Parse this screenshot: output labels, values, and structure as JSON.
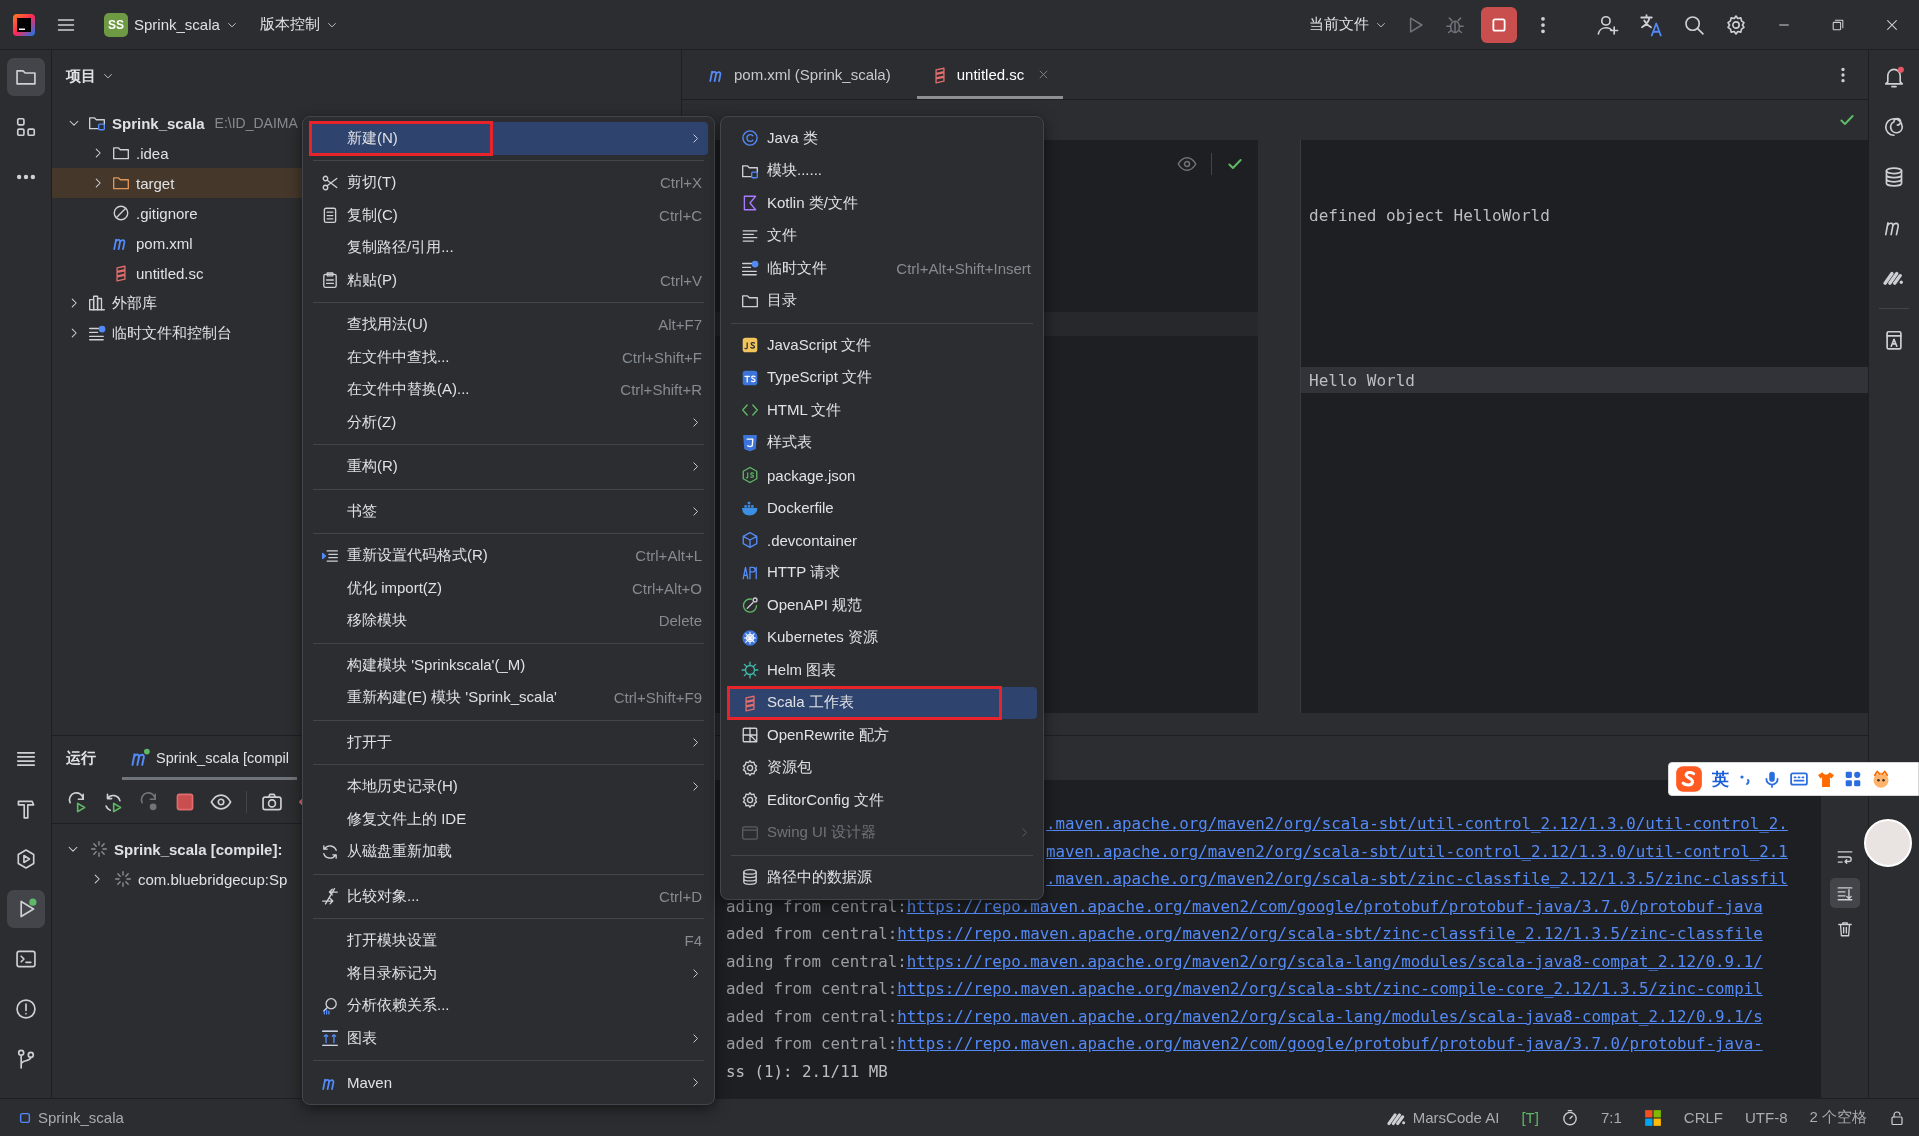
{
  "title_bar": {
    "project_badge": "SS",
    "project_name": "Sprink_scala",
    "vcs_menu": "版本控制",
    "run_config": "当前文件"
  },
  "left_toolbar": {
    "top": [
      {
        "selected": true
      },
      {
        "selected": false
      },
      {
        "selected": false
      }
    ],
    "bottom": [
      {
        "selected": false
      },
      {
        "selected": false
      },
      {
        "selected": false
      },
      {
        "selected": true
      },
      {
        "selected": false
      },
      {
        "selected": false
      },
      {
        "selected": false
      }
    ]
  },
  "project_panel": {
    "title": "项目",
    "tree": [
      {
        "name": "Sprink_scala",
        "path": "E:\\ID_DAIMA",
        "kind": "module",
        "expanded": true,
        "selected": false,
        "children": [
          {
            "name": ".idea",
            "kind": "folder",
            "expanded": false,
            "selected": false
          },
          {
            "name": "target",
            "kind": "excluded",
            "expanded": false,
            "selected": true
          },
          {
            "name": ".gitignore",
            "kind": "ignore",
            "selected": false
          },
          {
            "name": "pom.xml",
            "kind": "maven",
            "selected": false
          },
          {
            "name": "untitled.sc",
            "kind": "scala",
            "selected": false
          }
        ]
      },
      {
        "name": "外部库",
        "kind": "library",
        "expanded": false,
        "selected": false
      },
      {
        "name": "临时文件和控制台",
        "kind": "scratch",
        "expanded": false,
        "selected": false
      }
    ]
  },
  "editor": {
    "tabs": [
      {
        "label": "pom.xml (Sprink_scala)",
        "kind": "maven",
        "selected": false,
        "closable": false
      },
      {
        "label": "untitled.sc",
        "kind": "scala",
        "selected": true,
        "closable": true
      }
    ],
    "output": [
      {
        "text": "defined object HelloWorld",
        "highlighted": false
      },
      {
        "text": "Hello World",
        "highlighted": true
      }
    ]
  },
  "run_panel": {
    "title": "运行",
    "tabs": [
      {
        "label": "Sprink_scala [compil",
        "selected": true
      }
    ],
    "tree": [
      {
        "label": "Sprink_scala [compile]:",
        "expanded": true,
        "children": [
          {
            "label": "com.bluebridgecup:Sp",
            "expanded": false
          }
        ]
      }
    ],
    "console": [
      {
        "link": ".maven.apache.org/maven2/org/scala-sbt/util-control_2.12/1.3.0/util-control_2."
      },
      {
        "link": "maven.apache.org/maven2/org/scala-sbt/util-control_2.12/1.3.0/util-control_2.1"
      },
      {
        "link": ".maven.apache.org/maven2/org/scala-sbt/zinc-classfile_2.12/1.3.5/zinc-classfil"
      },
      {
        "prefix": "ading from central:",
        "link": "https://repo.maven.apache.org/maven2/com/google/protobuf/protobuf-java/3.7.0/protobuf-java"
      },
      {
        "prefix": "aded from central:",
        "link": "https://repo.maven.apache.org/maven2/org/scala-sbt/zinc-classfile_2.12/1.3.5/zinc-classfile"
      },
      {
        "prefix": "ading from central:",
        "link": "https://repo.maven.apache.org/maven2/org/scala-lang/modules/scala-java8-compat_2.12/0.9.1/"
      },
      {
        "prefix": "aded from central:",
        "link": "https://repo.maven.apache.org/maven2/org/scala-sbt/zinc-compile-core_2.12/1.3.5/zinc-compil"
      },
      {
        "prefix": "aded from central:",
        "link": "https://repo.maven.apache.org/maven2/org/scala-lang/modules/scala-java8-compat_2.12/0.9.1/s"
      },
      {
        "prefix": "aded from central:",
        "link": "https://repo.maven.apache.org/maven2/com/google/protobuf/protobuf-java/3.7.0/protobuf-java-"
      },
      {
        "text": "ss (1): 2.1/11 MB"
      }
    ]
  },
  "context_menu": {
    "groups": [
      [
        {
          "label": "新建(N)",
          "has_submenu": true,
          "selected": true,
          "marked": true
        }
      ],
      [
        {
          "label": "剪切(T)",
          "shortcut": "Ctrl+X",
          "has_submenu": false,
          "selected": false,
          "marked": false
        },
        {
          "label": "复制(C)",
          "shortcut": "Ctrl+C",
          "has_submenu": false,
          "selected": false,
          "marked": false
        },
        {
          "label": "复制路径/引用...",
          "has_submenu": false,
          "selected": false,
          "marked": false
        },
        {
          "label": "粘贴(P)",
          "shortcut": "Ctrl+V",
          "has_submenu": false,
          "selected": false,
          "marked": false
        }
      ],
      [
        {
          "label": "查找用法(U)",
          "shortcut": "Alt+F7",
          "has_submenu": false,
          "selected": false,
          "marked": false
        },
        {
          "label": "在文件中查找...",
          "shortcut": "Ctrl+Shift+F",
          "has_submenu": false,
          "selected": false,
          "marked": false
        },
        {
          "label": "在文件中替换(A)...",
          "shortcut": "Ctrl+Shift+R",
          "has_submenu": false,
          "selected": false,
          "marked": false
        },
        {
          "label": "分析(Z)",
          "has_submenu": true,
          "selected": false,
          "marked": false
        }
      ],
      [
        {
          "label": "重构(R)",
          "has_submenu": true,
          "selected": false,
          "marked": false
        }
      ],
      [
        {
          "label": "书签",
          "has_submenu": true,
          "selected": false,
          "marked": false
        }
      ],
      [
        {
          "label": "重新设置代码格式(R)",
          "shortcut": "Ctrl+Alt+L",
          "has_submenu": false,
          "selected": false,
          "marked": false
        },
        {
          "label": "优化 import(Z)",
          "shortcut": "Ctrl+Alt+O",
          "has_submenu": false,
          "selected": false,
          "marked": false
        },
        {
          "label": "移除模块",
          "shortcut": "Delete",
          "has_submenu": false,
          "selected": false,
          "marked": false
        }
      ],
      [
        {
          "label": "构建模块 'Sprinkscala'(_M)",
          "has_submenu": false,
          "selected": false,
          "marked": false
        },
        {
          "label": "重新构建(E) 模块 'Sprink_scala'",
          "shortcut": "Ctrl+Shift+F9",
          "has_submenu": false,
          "selected": false,
          "marked": false
        }
      ],
      [
        {
          "label": "打开于",
          "has_submenu": true,
          "selected": false,
          "marked": false
        }
      ],
      [
        {
          "label": "本地历史记录(H)",
          "has_submenu": true,
          "selected": false,
          "marked": false
        },
        {
          "label": "修复文件上的 IDE",
          "has_submenu": false,
          "selected": false,
          "marked": false
        },
        {
          "label": "从磁盘重新加载",
          "has_submenu": false,
          "selected": false,
          "marked": false
        }
      ],
      [
        {
          "label": "比较对象...",
          "shortcut": "Ctrl+D",
          "has_submenu": false,
          "selected": false,
          "marked": false
        }
      ],
      [
        {
          "label": "打开模块设置",
          "shortcut": "F4",
          "has_submenu": false,
          "selected": false,
          "marked": false
        },
        {
          "label": "将目录标记为",
          "has_submenu": true,
          "selected": false,
          "marked": false
        },
        {
          "label": "分析依赖关系...",
          "has_submenu": false,
          "selected": false,
          "marked": false
        },
        {
          "label": "图表",
          "has_submenu": true,
          "selected": false,
          "marked": false
        }
      ],
      [
        {
          "label": "Maven",
          "has_submenu": true,
          "selected": false,
          "marked": false
        }
      ]
    ]
  },
  "new_submenu": {
    "groups": [
      [
        {
          "label": "Java 类",
          "has_submenu": false,
          "selected": false,
          "disabled": false,
          "marked": false
        },
        {
          "label": "模块......",
          "has_submenu": false,
          "selected": false,
          "disabled": false,
          "marked": false
        },
        {
          "label": "Kotlin 类/文件",
          "has_submenu": false,
          "selected": false,
          "disabled": false,
          "marked": false
        },
        {
          "label": "文件",
          "has_submenu": false,
          "selected": false,
          "disabled": false,
          "marked": false
        },
        {
          "label": "临时文件",
          "shortcut": "Ctrl+Alt+Shift+Insert",
          "has_submenu": false,
          "selected": false,
          "disabled": false,
          "marked": false
        },
        {
          "label": "目录",
          "has_submenu": false,
          "selected": false,
          "disabled": false,
          "marked": false
        }
      ],
      [
        {
          "label": "JavaScript 文件",
          "has_submenu": false,
          "selected": false,
          "disabled": false,
          "marked": false
        },
        {
          "label": "TypeScript 文件",
          "has_submenu": false,
          "selected": false,
          "disabled": false,
          "marked": false
        },
        {
          "label": "HTML 文件",
          "has_submenu": false,
          "selected": false,
          "disabled": false,
          "marked": false
        },
        {
          "label": "样式表",
          "has_submenu": false,
          "selected": false,
          "disabled": false,
          "marked": false
        },
        {
          "label": "package.json",
          "has_submenu": false,
          "selected": false,
          "disabled": false,
          "marked": false
        },
        {
          "label": "Dockerfile",
          "has_submenu": false,
          "selected": false,
          "disabled": false,
          "marked": false
        },
        {
          "label": ".devcontainer",
          "has_submenu": false,
          "selected": false,
          "disabled": false,
          "marked": false
        },
        {
          "label": "HTTP 请求",
          "has_submenu": false,
          "selected": false,
          "disabled": false,
          "marked": false
        },
        {
          "label": "OpenAPI 规范",
          "has_submenu": false,
          "selected": false,
          "disabled": false,
          "marked": false
        },
        {
          "label": "Kubernetes 资源",
          "has_submenu": false,
          "selected": false,
          "disabled": false,
          "marked": false
        },
        {
          "label": "Helm 图表",
          "has_submenu": false,
          "selected": false,
          "disabled": false,
          "marked": false
        },
        {
          "label": "Scala 工作表",
          "has_submenu": false,
          "selected": true,
          "disabled": false,
          "marked": true
        },
        {
          "label": "OpenRewrite 配方",
          "has_submenu": false,
          "selected": false,
          "disabled": false,
          "marked": false
        },
        {
          "label": "资源包",
          "has_submenu": false,
          "selected": false,
          "disabled": false,
          "marked": false
        },
        {
          "label": "EditorConfig 文件",
          "has_submenu": false,
          "selected": false,
          "disabled": false,
          "marked": false
        },
        {
          "label": "Swing UI 设计器",
          "has_submenu": true,
          "selected": false,
          "disabled": true,
          "marked": false
        }
      ],
      [
        {
          "label": "路径中的数据源",
          "has_submenu": false,
          "selected": false,
          "disabled": false,
          "marked": false
        }
      ]
    ]
  },
  "status_bar": {
    "project": "Sprink_scala",
    "items": [
      "MarsCode AI",
      "[T]",
      "7:1",
      "CRLF",
      "UTF-8",
      "2 个空格"
    ]
  },
  "input_method_bar": {
    "mode": "英"
  }
}
